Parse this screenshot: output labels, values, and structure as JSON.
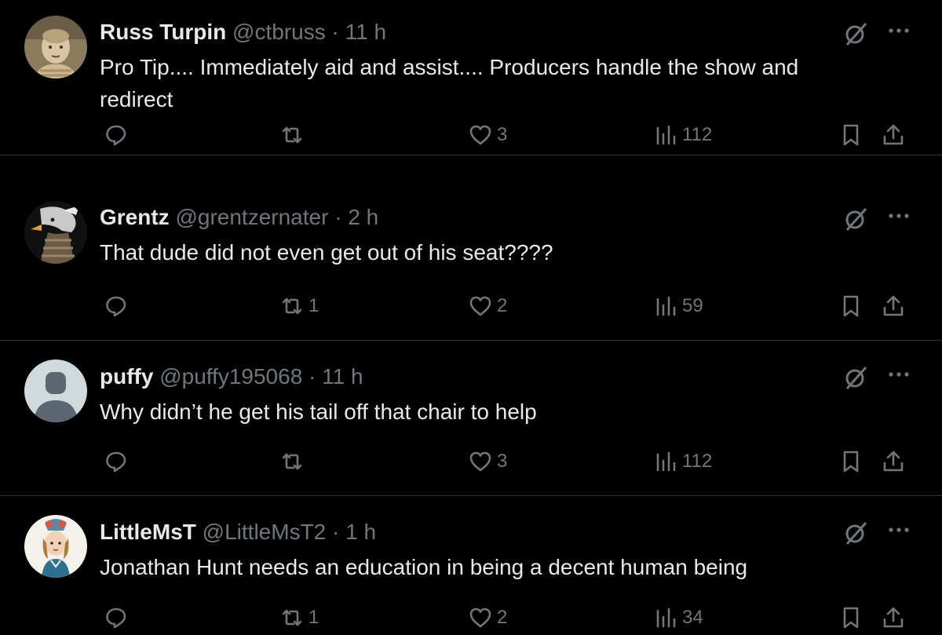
{
  "tweets": [
    {
      "name": "Russ Turpin",
      "handle": "@ctbruss",
      "time": "· 11 h",
      "text": "Pro Tip.... Immediately aid and assist.... Producers handle the show and redirect",
      "replies": "",
      "retweets": "",
      "likes": "3",
      "views": "112",
      "avatar": "child-photo-avatar"
    },
    {
      "name": "Grentz",
      "handle": "@grentzernater",
      "time": "· 2 h",
      "text": "That dude did not even get out of his seat????",
      "replies": "",
      "retweets": "1",
      "likes": "2",
      "views": "59",
      "avatar": "eagle-warrior-avatar"
    },
    {
      "name": "puffy",
      "handle": "@puffy195068",
      "time": "· 11 h",
      "text": "Why didn’t he get his tail off that chair to help",
      "replies": "",
      "retweets": "",
      "likes": "3",
      "views": "112",
      "avatar": "default-avatar"
    },
    {
      "name": "LittleMsT",
      "handle": "@LittleMsT2",
      "time": "· 1 h",
      "text": "Jonathan Hunt needs an education in being a decent human being",
      "replies": "",
      "retweets": "1",
      "likes": "2",
      "views": "34",
      "avatar": "vintage-girl-avatar"
    }
  ],
  "colors": {
    "background": "#000000",
    "text": "#e7e9ea",
    "secondary": "#71767b",
    "divider": "#2f3336"
  }
}
